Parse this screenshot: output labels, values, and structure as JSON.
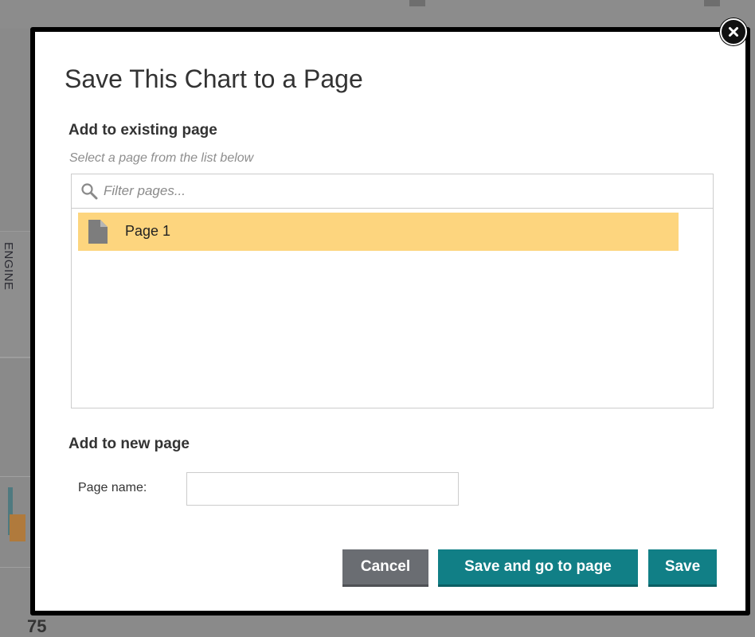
{
  "background": {
    "vertical_text": "ENGINE",
    "bottom_text": "75"
  },
  "dialog": {
    "title": "Save This Chart to a Page",
    "close_icon": "close-icon",
    "existing": {
      "heading": "Add to existing page",
      "hint": "Select a page from the list below",
      "filter_placeholder": "Filter pages...",
      "filter_icon": "search-icon",
      "pages": [
        {
          "label": "Page 1",
          "icon": "page-icon",
          "selected": true
        }
      ]
    },
    "new_page": {
      "heading": "Add to new page",
      "name_label": "Page name:",
      "name_value": ""
    },
    "buttons": {
      "cancel": "Cancel",
      "save_and_go": "Save and go to page",
      "save": "Save"
    }
  },
  "colors": {
    "selected_item": "#fdd57e",
    "primary_button": "#117f86",
    "cancel_button": "#6a6d72",
    "modal_border": "#000000"
  }
}
